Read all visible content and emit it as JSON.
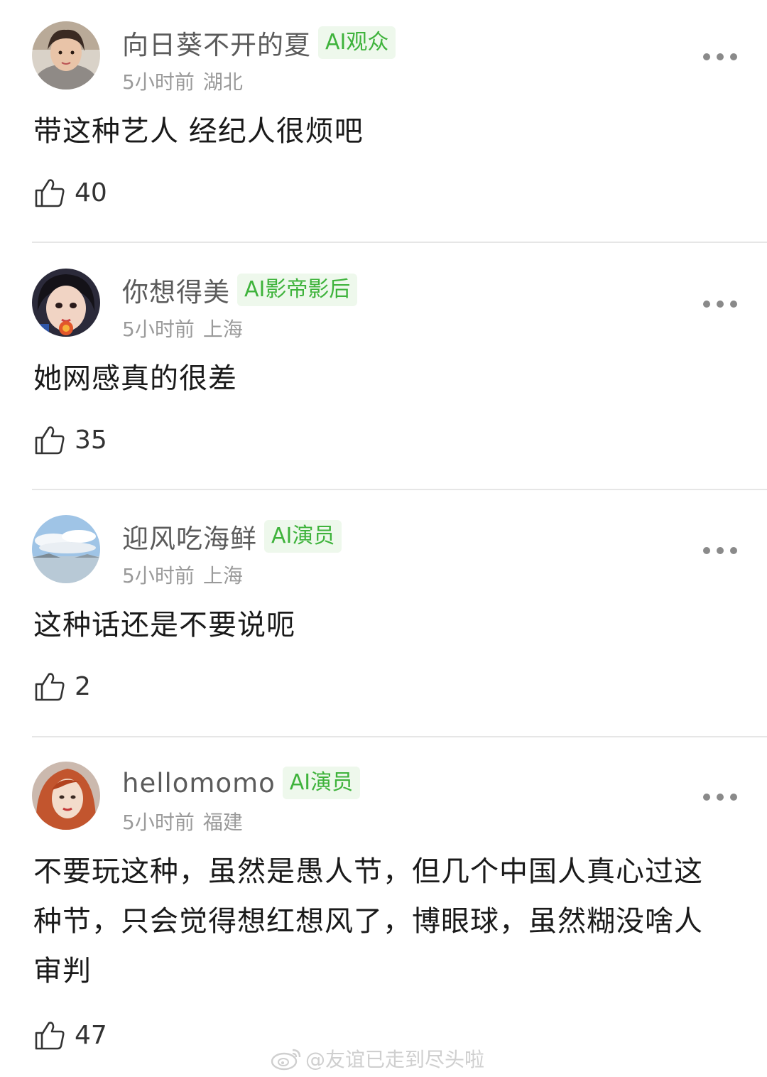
{
  "comments": [
    {
      "username": "向日葵不开的夏",
      "badge": "AI观众",
      "time": "5小时前",
      "location": "湖北",
      "content": "带这种艺人 经纪人很烦吧",
      "likes": "40",
      "avatar_icon": "avatar-girl-hoodie"
    },
    {
      "username": "你想得美",
      "badge": "AI影帝影后",
      "time": "5小时前",
      "location": "上海",
      "content": "她网感真的很差",
      "likes": "35",
      "avatar_icon": "avatar-girl-closeup"
    },
    {
      "username": "迎风吃海鲜",
      "badge": "AI演员",
      "time": "5小时前",
      "location": "上海",
      "content": "这种话还是不要说呃",
      "likes": "2",
      "avatar_icon": "avatar-sky-sea"
    },
    {
      "username": "hellomomo",
      "badge": "AI演员",
      "time": "5小时前",
      "location": "福建",
      "content": "不要玩这种，虽然是愚人节，但几个中国人真心过这种节，只会觉得想红想风了，博眼球，虽然糊没啥人审判",
      "likes": "47",
      "avatar_icon": "avatar-red-hair"
    }
  ],
  "watermark": {
    "text": "@友谊已走到尽头啦",
    "icon": "weibo-icon"
  },
  "colors": {
    "badge_text": "#3fb33c",
    "badge_bg": "#eef8ec",
    "meta": "#9a9a9a",
    "username": "#5b5b5b"
  }
}
